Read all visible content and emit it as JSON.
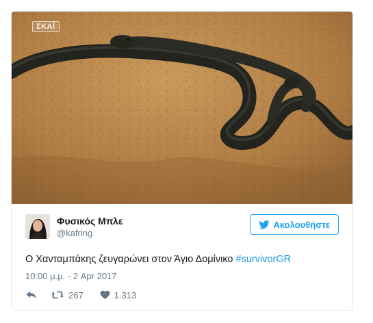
{
  "media": {
    "channel_logo": "ΣΚΑΪ",
    "colors": {
      "sand": "#b8864c",
      "snake": "#2a2a26"
    }
  },
  "user": {
    "display_name": "Φυσικός Μπλε",
    "handle": "@kafring"
  },
  "follow_button": {
    "label": "Ακολουθήστε",
    "icon": "twitter-bird-icon",
    "color": "#1da1f2"
  },
  "tweet": {
    "text": "Ο Χανταμπάκης ζευγαρώνει στον Άγιο Δομίνικο ",
    "hashtag": "#survivorGR",
    "timestamp": "10:00 μ.μ. - 2 Apr 2017"
  },
  "actions": {
    "reply_icon": "reply-icon",
    "retweet_icon": "retweet-icon",
    "retweet_count": "267",
    "like_icon": "heart-icon",
    "like_count": "1.313"
  },
  "colors": {
    "text": "#14171a",
    "muted": "#657786",
    "link": "#1b95e0",
    "border": "#e1e8ed"
  }
}
